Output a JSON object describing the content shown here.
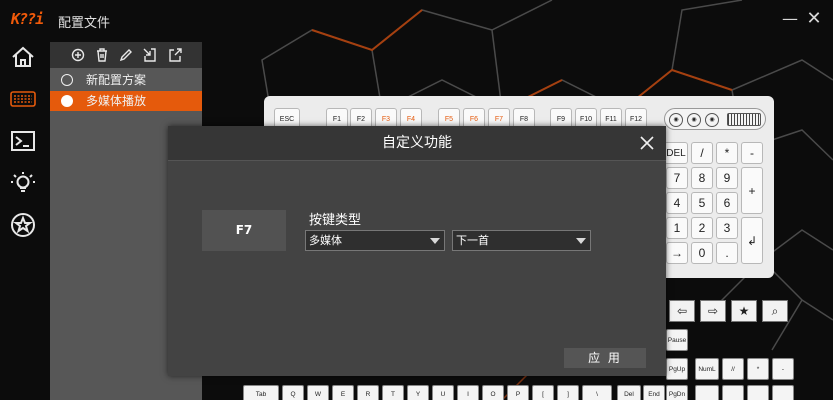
{
  "app": {
    "logo_text": "K??i",
    "title": "配置文件",
    "minimize_glyph": "—",
    "close_glyph": "✕"
  },
  "nav": {
    "icons": [
      "home-icon",
      "keyboard-icon",
      "terminal-icon",
      "lightbulb-icon",
      "star-icon"
    ]
  },
  "colors": {
    "accent": "#e55a0c",
    "panel": "#575757",
    "modal": "#434343"
  },
  "profiles": {
    "toolbar_icons": [
      "add-icon",
      "delete-icon",
      "edit-icon",
      "import-icon",
      "export-icon"
    ],
    "items": [
      {
        "label": "新配置方案",
        "selected": false
      },
      {
        "label": "多媒体播放",
        "selected": true
      }
    ]
  },
  "keyboard": {
    "function_row": [
      "ESC",
      "F1",
      "F2",
      "F3",
      "F4",
      "F5",
      "F6",
      "F7",
      "F8",
      "F9",
      "F10",
      "F11",
      "F12"
    ],
    "orange_keys": [
      "F3",
      "F4",
      "F5",
      "F6",
      "F7"
    ],
    "numpad": [
      "DEL",
      "/",
      "*",
      "-",
      "7",
      "8",
      "9",
      "+",
      "4",
      "5",
      "6",
      "1",
      "2",
      "3",
      "0",
      "."
    ],
    "bottom_row_1": [
      "Tab",
      "Q",
      "W",
      "E",
      "R",
      "T",
      "Y",
      "U",
      "I",
      "O",
      "P",
      "[",
      "]",
      "\\"
    ],
    "side_keys": [
      "Pause",
      "PgUp",
      "NumL",
      "//",
      "*",
      "-",
      "Del",
      "End",
      "PgDn"
    ]
  },
  "modal": {
    "title": "自定义功能",
    "key_name": "F7",
    "field_label": "按键类型",
    "type_value": "多媒体",
    "action_value": "下一首",
    "apply_label": "应 用"
  }
}
